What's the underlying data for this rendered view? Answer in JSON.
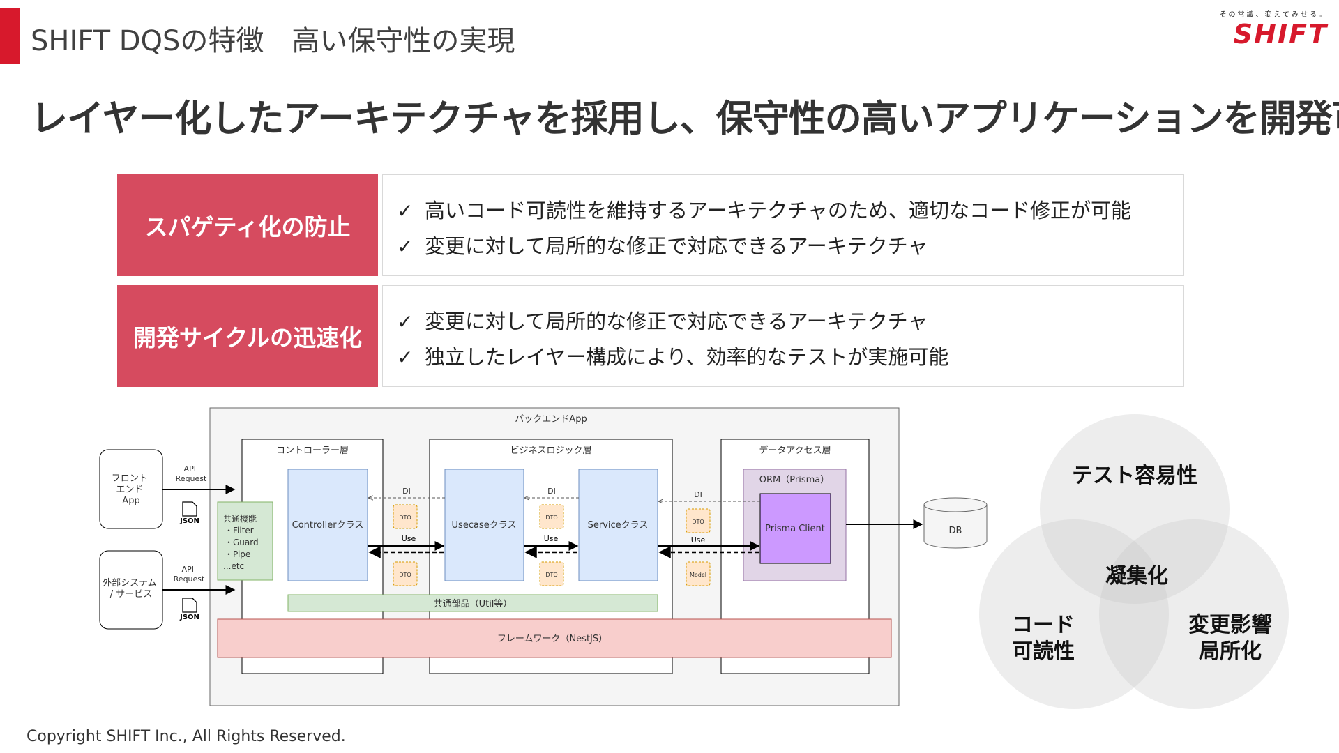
{
  "header": {
    "slide_title": "SHIFT DQSの特徴　高い保守性の実現",
    "logo_tagline": "その常識、変えてみせる。",
    "logo_text": "SHIFT"
  },
  "main_title": "レイヤー化したアーキテクチャを採用し、保守性の高いアプリケーションを開発可能",
  "features": [
    {
      "label": "スパゲティ化の防止",
      "items": [
        "高いコード可読性を維持するアーキテクチャのため、適切なコード修正が可能",
        "変更に対して局所的な修正で対応できるアーキテクチャ"
      ]
    },
    {
      "label": "開発サイクルの迅速化",
      "items": [
        "変更に対して局所的な修正で対応できるアーキテクチャ",
        "独立したレイヤー構成により、効率的なテストが実施可能"
      ]
    }
  ],
  "check_mark": "✓",
  "diagram": {
    "backend_title": "バックエンドApp",
    "frontend_app": "フロント\nエンド\nApp",
    "external_system": "外部システム\n/ サービス",
    "api_request": "API\nRequest",
    "json": "JSON",
    "controller_layer": "コントローラー層",
    "business_layer": "ビジネスロジック層",
    "data_access_layer": "データアクセス層",
    "common_functions": "共通機能\n・Filter\n・Guard\n・Pipe\n...etc",
    "controller_class": "Controllerクラス",
    "usecase_class": "Usecaseクラス",
    "service_class": "Serviceクラス",
    "orm": "ORM（Prisma）",
    "prisma_client": "Prisma Client",
    "db": "DB",
    "di": "DI",
    "use": "Use",
    "dto": "DTO",
    "model": "Model",
    "common_parts": "共通部品（Util等）",
    "framework": "フレームワーク（NestJS）"
  },
  "venn": {
    "top": "テスト容易性",
    "left": "コード\n可読性",
    "right": "変更影響\n局所化",
    "center": "凝集化"
  },
  "copyright": "Copyright SHIFT Inc., All Rights Reserved.",
  "colors": {
    "brand_red": "#d7192c",
    "feature_label_bg": "#d64b5f",
    "class_box": "#dae8fc",
    "common_green": "#d5e8d4",
    "framework_red": "#f8cecc",
    "dto_orange": "#ffe6cc",
    "orm_purple": "#e1d5e7",
    "prisma_purple": "#cc99ff"
  }
}
